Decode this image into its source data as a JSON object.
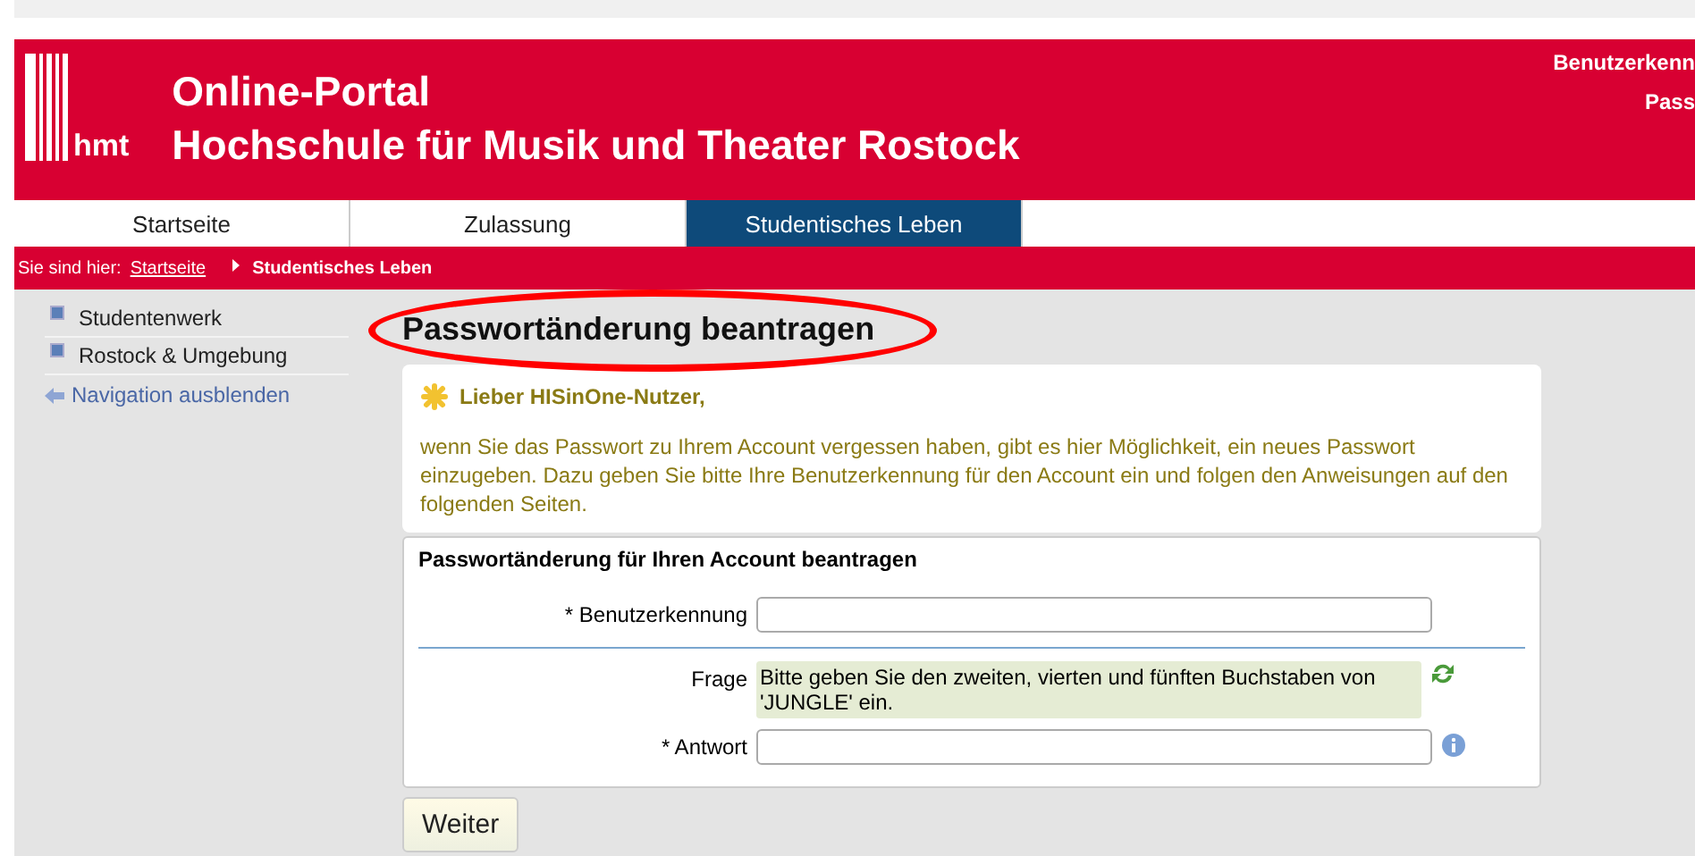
{
  "header": {
    "logo_text": "hmt",
    "title": "Online-Portal",
    "subtitle": "Hochschule für Musik und Theater Rostock",
    "login_labels": [
      "Benutzerkenn",
      "Pass"
    ]
  },
  "tabs": [
    {
      "label": "Startseite",
      "selected": false
    },
    {
      "label": "Zulassung",
      "selected": false
    },
    {
      "label": "Studentisches Leben",
      "selected": true
    }
  ],
  "breadcrumb": {
    "prefix": "Sie sind hier:",
    "items": [
      {
        "label": "Startseite",
        "kind": "link"
      },
      {
        "label": "Studentisches Leben",
        "kind": "current"
      }
    ]
  },
  "sidebar": {
    "items": [
      {
        "label": "Studentenwerk"
      },
      {
        "label": "Rostock & Umgebung"
      }
    ],
    "hide_link": "Navigation ausblenden"
  },
  "page_title": "Passwortänderung beantragen",
  "notice": {
    "heading": "Lieber HISinOne-Nutzer,",
    "text": "wenn Sie das Passwort zu Ihrem Account vergessen haben, gibt es hier Möglichkeit, ein neues Passwort einzugeben. Dazu geben Sie bitte Ihre Benutzerkennung für den Account ein und folgen den Anweisungen auf den folgenden Seiten."
  },
  "form": {
    "title": "Passwortänderung für Ihren Account beantragen",
    "fields": [
      {
        "kind": "input",
        "label": "* Benutzerkennung"
      },
      {
        "kind": "question",
        "label": "Frage",
        "value": "Bitte geben Sie den zweiten, vierten und fünften Buchstaben von 'JUNGLE' ein."
      },
      {
        "kind": "input",
        "label": "* Antwort",
        "info": true
      }
    ]
  },
  "submit_button": "Weiter"
}
